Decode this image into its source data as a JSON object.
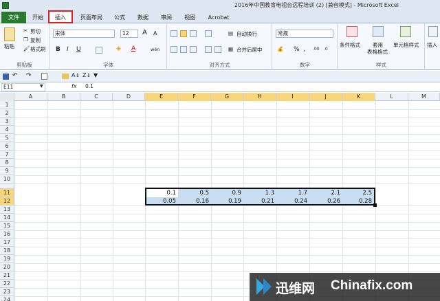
{
  "window": {
    "title": "2016年中国教育电视台远程培训 (2)  [兼容模式] - Microsoft Excel"
  },
  "tabs": {
    "file": "文件",
    "home": "开始",
    "insert": "插入",
    "page_layout": "页面布局",
    "formulas": "公式",
    "data": "数据",
    "review": "审阅",
    "view": "视图",
    "acrobat": "Acrobat"
  },
  "ribbon": {
    "clipboard": {
      "paste": "粘贴",
      "cut": "剪切",
      "copy": "复制",
      "format_painter": "格式刷",
      "label": "剪贴板"
    },
    "font": {
      "name": "宋体",
      "size": "12",
      "grow": "A",
      "shrink": "A",
      "bold": "B",
      "italic": "I",
      "underline": "U",
      "font_color": "A",
      "phonetic": "wén",
      "label": "字体"
    },
    "alignment": {
      "wrap": "自动换行",
      "merge": "合并后居中",
      "label": "对齐方式"
    },
    "number": {
      "format": "常规",
      "percent": "%",
      "comma": ",",
      "label": "数字"
    },
    "styles": {
      "conditional": "条件格式",
      "table_line1": "套用",
      "table_line2": "表格格式",
      "cell_styles": "单元格样式",
      "label": "样式"
    },
    "cells": {
      "insert": "插入"
    }
  },
  "formula_bar": {
    "name_box": "E11",
    "fx": "fx",
    "value": "0.1"
  },
  "grid": {
    "columns": [
      "A",
      "B",
      "C",
      "D",
      "E",
      "F",
      "G",
      "H",
      "I",
      "J",
      "K",
      "L",
      "M"
    ],
    "rows": [
      "1",
      "2",
      "3",
      "4",
      "5",
      "6",
      "7",
      "8",
      "9",
      "10",
      "11",
      "12",
      "13",
      "14",
      "15",
      "16",
      "17",
      "18",
      "19",
      "20",
      "21",
      "22",
      "23",
      "24"
    ],
    "selected_columns": [
      "E",
      "F",
      "G",
      "H",
      "I",
      "J",
      "K"
    ],
    "selected_rows": [
      "11",
      "12"
    ],
    "row11": [
      "0.1",
      "0.5",
      "0.9",
      "1.3",
      "1.7",
      "2.1",
      "2.5"
    ],
    "row12": [
      "0.05",
      "0.16",
      "0.19",
      "0.21",
      "0.24",
      "0.26",
      "0.28"
    ]
  },
  "watermark": {
    "brand_cn": "迅维网",
    "brand_en": "Chinafix.com"
  },
  "colors": {
    "file_tab": "#2a7a2e",
    "selection_fill": "#c9def5",
    "header_highlight": "#f7d77a",
    "annotation_red": "#e02020"
  }
}
